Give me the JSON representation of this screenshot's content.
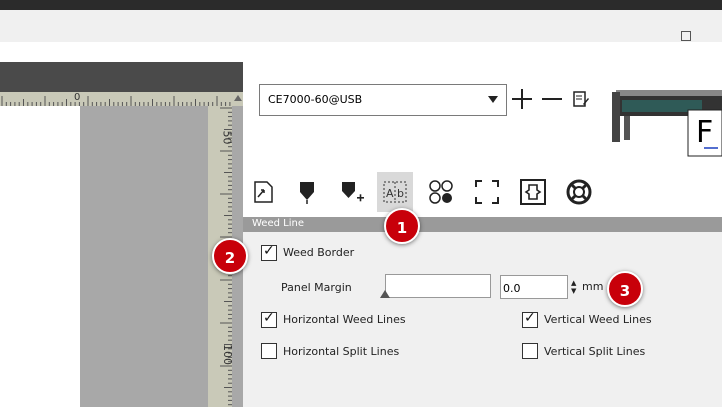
{
  "ruler": {
    "top_zero": "0",
    "left_marks": [
      "50",
      "100"
    ]
  },
  "device": {
    "selected": "CE7000-60@USB"
  },
  "section": {
    "title": "Weed Line"
  },
  "form": {
    "weed_border": {
      "label": "Weed Border",
      "checked": true
    },
    "panel_margin": {
      "label": "Panel Margin",
      "value": "0.0",
      "unit": "mm"
    },
    "horizontal_weed": {
      "label": "Horizontal Weed Lines",
      "checked": true
    },
    "vertical_weed": {
      "label": "Vertical Weed Lines",
      "checked": true
    },
    "horizontal_split": {
      "label": "Horizontal Split Lines",
      "checked": false
    },
    "vertical_split": {
      "label": "Vertical Split Lines",
      "checked": false
    }
  },
  "badges": [
    "1",
    "2",
    "3"
  ],
  "icons": [
    "page-setup-icon",
    "pen-cut-icon",
    "pen-add-icon",
    "weed-line-icon",
    "registration-marks-icon",
    "crop-frame-icon",
    "output-icon",
    "help-icon"
  ],
  "colors": {
    "badge": "#c8000a",
    "section_bar": "#9a9a9a",
    "panel_bg": "#f0f0f0"
  }
}
